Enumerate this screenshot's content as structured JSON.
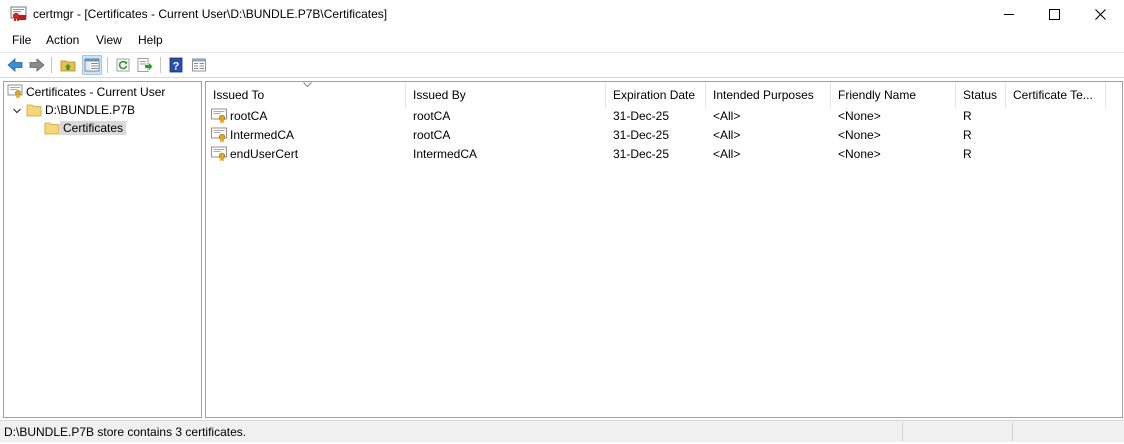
{
  "window": {
    "title": "certmgr - [Certificates - Current User\\D:\\BUNDLE.P7B\\Certificates]"
  },
  "menu": [
    "File",
    "Action",
    "View",
    "Help"
  ],
  "toolbar": {
    "buttons": [
      "back-icon",
      "forward-icon",
      "up-folder-icon",
      "show-hide-tree-icon",
      "refresh-icon",
      "export-list-icon",
      "help-icon",
      "properties-view-icon"
    ]
  },
  "tree": {
    "root": "Certificates - Current User",
    "store": "D:\\BUNDLE.P7B",
    "folder": "Certificates"
  },
  "list": {
    "columns": [
      "Issued To",
      "Issued By",
      "Expiration Date",
      "Intended Purposes",
      "Friendly Name",
      "Status",
      "Certificate Te..."
    ],
    "rows": [
      {
        "issued_to": "rootCA",
        "issued_by": "rootCA",
        "expiration": "31-Dec-25",
        "purposes": "<All>",
        "friendly": "<None>",
        "status": "R"
      },
      {
        "issued_to": "IntermedCA",
        "issued_by": "rootCA",
        "expiration": "31-Dec-25",
        "purposes": "<All>",
        "friendly": "<None>",
        "status": "R"
      },
      {
        "issued_to": "endUserCert",
        "issued_by": "IntermedCA",
        "expiration": "31-Dec-25",
        "purposes": "<All>",
        "friendly": "<None>",
        "status": "R"
      }
    ]
  },
  "status": {
    "text": "D:\\BUNDLE.P7B store contains 3 certificates."
  }
}
